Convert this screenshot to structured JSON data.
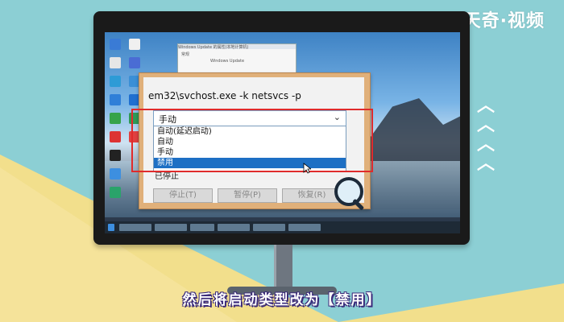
{
  "brand": {
    "logo_text": "天奇·视频"
  },
  "colors": {
    "accent_red": "#e02b2b",
    "selection_blue": "#1d6fc4",
    "caption_outline": "#3a2a7a"
  },
  "background_window": {
    "title": "Windows Update 的属性(本地计算机)",
    "line1": "常规",
    "line2": "Windows Update"
  },
  "dialog": {
    "command_line": "em32\\svchost.exe -k netsvcs -p",
    "startup_type_value": "手动",
    "options": [
      "自动(延迟启动)",
      "自动",
      "手动",
      "禁用"
    ],
    "selected_option": "禁用",
    "status_partial": "已停止",
    "buttons": {
      "stop": "停止(T)",
      "pause": "暂停(P)",
      "resume": "恢复(R)"
    }
  },
  "icons": {
    "dropdown": "chevron-down-icon",
    "cursor": "mouse-pointer-icon",
    "magnifier": "magnifier-icon",
    "up": "chevron-up-icon"
  },
  "caption": "然后将启动类型改为【禁用】"
}
